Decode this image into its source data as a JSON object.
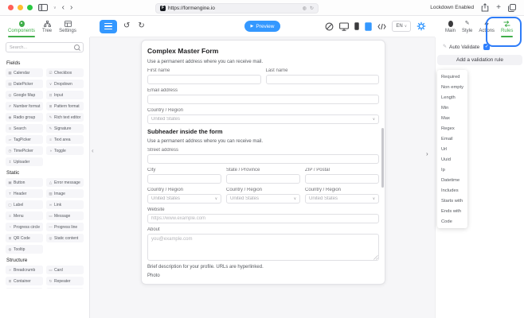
{
  "colors": {
    "accent_blue": "#3498ff",
    "accent_green": "#3fae49",
    "highlight_ring": "#2e7cf8"
  },
  "glyphs": {
    "chevron_down": "∨",
    "collapse_left": "‹",
    "expand_right": "›",
    "url_badge": "◍",
    "url_reload": "↻",
    "plus": "+",
    "back": "‹",
    "forward": "›",
    "window_chevron": "∨",
    "check": "✓"
  },
  "browser": {
    "url": "https://formengine.io",
    "favicon_letter": "F",
    "lockdown_label": "Lockdown Enabled"
  },
  "toolbar": {
    "undo_glyph": "↺",
    "redo_glyph": "↻",
    "preview_play_glyph": "▶",
    "preview_label": "Preview",
    "language_value": "EN"
  },
  "left_panel": {
    "tabs": [
      {
        "label": "Components",
        "active": true
      },
      {
        "label": "Tree",
        "active": false
      },
      {
        "label": "Settings",
        "active": false
      }
    ],
    "search_placeholder": "Search...",
    "sections": [
      {
        "title": "Fields",
        "items": [
          {
            "id": "calendar",
            "label": "Calendar",
            "glyph": "▦"
          },
          {
            "id": "checkbox",
            "label": "Checkbox",
            "glyph": "☑"
          },
          {
            "id": "datepicker",
            "label": "DatePicker",
            "glyph": "▤"
          },
          {
            "id": "dropdown",
            "label": "Dropdown",
            "glyph": "∨"
          },
          {
            "id": "google-map",
            "label": "Google Map",
            "glyph": "◎"
          },
          {
            "id": "input",
            "label": "Input",
            "glyph": "⊡"
          },
          {
            "id": "number-format",
            "label": "Number format",
            "glyph": "#"
          },
          {
            "id": "pattern-format",
            "label": "Pattern format",
            "glyph": "⊞"
          },
          {
            "id": "radio-group",
            "label": "Radio group",
            "glyph": "◉"
          },
          {
            "id": "rich-text-editor",
            "label": "Rich text editor",
            "glyph": "✎"
          },
          {
            "id": "search",
            "label": "Search",
            "glyph": "⊙"
          },
          {
            "id": "signature",
            "label": "Signature",
            "glyph": "✎"
          },
          {
            "id": "tagpicker",
            "label": "TagPicker",
            "glyph": "▱"
          },
          {
            "id": "text-area",
            "label": "Text area",
            "glyph": "≡"
          },
          {
            "id": "timepicker",
            "label": "TimePicker",
            "glyph": "◷"
          },
          {
            "id": "toggle",
            "label": "Toggle",
            "glyph": "◑"
          },
          {
            "id": "uploader",
            "label": "Uploader",
            "glyph": "↥"
          }
        ]
      },
      {
        "title": "Static",
        "items": [
          {
            "id": "button",
            "label": "Button",
            "glyph": "▣"
          },
          {
            "id": "error-message",
            "label": "Error message",
            "glyph": "△"
          },
          {
            "id": "header",
            "label": "Header",
            "glyph": "T"
          },
          {
            "id": "image",
            "label": "Image",
            "glyph": "▧"
          },
          {
            "id": "label",
            "label": "Label",
            "glyph": "▢"
          },
          {
            "id": "link",
            "label": "Link",
            "glyph": "∞"
          },
          {
            "id": "menu",
            "label": "Menu",
            "glyph": "≡"
          },
          {
            "id": "message",
            "label": "Message",
            "glyph": "▭"
          },
          {
            "id": "progress-circle",
            "label": "Progress circle",
            "glyph": "◔"
          },
          {
            "id": "progress-line",
            "label": "Progress line",
            "glyph": "—"
          },
          {
            "id": "qr-code",
            "label": "QR Code",
            "glyph": "⊞"
          },
          {
            "id": "static-content",
            "label": "Static content",
            "glyph": "◎"
          },
          {
            "id": "tooltip",
            "label": "Tooltip",
            "glyph": "◍"
          }
        ]
      },
      {
        "title": "Structure",
        "partial_row": true,
        "items": [
          {
            "id": "breadcrumb",
            "label": "Breadcrumb",
            "glyph": "»"
          },
          {
            "id": "card",
            "label": "Card",
            "glyph": "▭"
          },
          {
            "id": "container",
            "label": "Container",
            "glyph": "⊞"
          },
          {
            "id": "repeater",
            "label": "Repeater",
            "glyph": "↻"
          }
        ]
      }
    ]
  },
  "form": {
    "rows": [
      {
        "type": "title",
        "text": "Complex Master Form"
      },
      {
        "type": "hint",
        "text": "Use a permanent address where you can receive mail."
      },
      {
        "type": "fields",
        "cols": [
          {
            "control": "input",
            "label": "First name"
          },
          {
            "control": "input",
            "label": "Last name"
          }
        ]
      },
      {
        "type": "fields",
        "cols": [
          {
            "control": "input",
            "label": "Email address"
          }
        ]
      },
      {
        "type": "fields",
        "cols": [
          {
            "control": "select",
            "label": "Country / Region",
            "value": "United States"
          }
        ]
      },
      {
        "type": "subtitle",
        "text": "Subheader inside the form"
      },
      {
        "type": "hint",
        "text": "Use a permanent address where you can receive mail."
      },
      {
        "type": "fields",
        "cols": [
          {
            "control": "input",
            "label": "Street address"
          }
        ]
      },
      {
        "type": "fields",
        "cols": [
          {
            "control": "input",
            "label": "City"
          },
          {
            "control": "input",
            "label": "State / Province"
          },
          {
            "control": "input",
            "label": "ZIP / Postal"
          }
        ]
      },
      {
        "type": "fields",
        "cols": [
          {
            "control": "select",
            "label": "Country / Region",
            "value": "United States"
          },
          {
            "control": "select",
            "label": "Country / Region",
            "value": "United States"
          },
          {
            "control": "select",
            "label": "Country / Region",
            "value": "United States"
          }
        ]
      },
      {
        "type": "fields",
        "cols": [
          {
            "control": "input",
            "label": "Website",
            "placeholder": "https://www.example.com"
          }
        ]
      },
      {
        "type": "fields",
        "cols": [
          {
            "control": "textarea",
            "label": "About",
            "placeholder": "you@example.com"
          }
        ]
      },
      {
        "type": "hint",
        "text": "Brief description for your profile. URLs are hyperlinked."
      },
      {
        "type": "text",
        "text": "Photo"
      }
    ]
  },
  "right_panel": {
    "tabs": [
      {
        "label": "Main",
        "active": false
      },
      {
        "label": "Style",
        "active": false
      },
      {
        "label": "Actions",
        "active": false
      },
      {
        "label": "Rules",
        "active": true
      }
    ],
    "auto_validate_label": "Auto Validate",
    "auto_validate_checked": true,
    "add_rule_label": "Add a validation rule",
    "rule_options": [
      "Required",
      "Non empty",
      "Length",
      "Min",
      "Max",
      "Regex",
      "Email",
      "Url",
      "Uuid",
      "Ip",
      "Datetime",
      "Includes",
      "Starts with",
      "Ends with",
      "Code"
    ]
  }
}
